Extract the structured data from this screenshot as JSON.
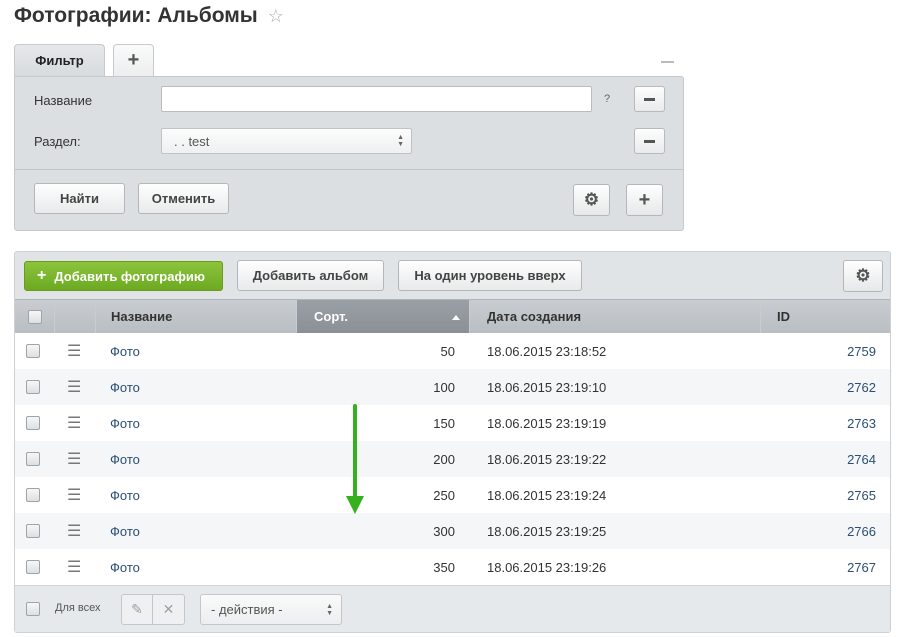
{
  "page": {
    "title": "Фотографии: Альбомы"
  },
  "filter": {
    "tab_label": "Фильтр",
    "name_label": "Название",
    "name_value": "",
    "help_mark": "?",
    "section_label": "Раздел:",
    "section_value": ". . test",
    "find_button": "Найти",
    "cancel_button": "Отменить"
  },
  "toolbar": {
    "add_photo": "Добавить фотографию",
    "add_album": "Добавить альбом",
    "level_up": "На один уровень вверх"
  },
  "table": {
    "columns": [
      "Название",
      "Сорт.",
      "Дата создания",
      "ID"
    ],
    "sorted_column": "Сорт.",
    "rows": [
      {
        "name": "Фото",
        "sort": "50",
        "date": "18.06.2015 23:18:52",
        "id": "2759"
      },
      {
        "name": "Фото",
        "sort": "100",
        "date": "18.06.2015 23:19:10",
        "id": "2762"
      },
      {
        "name": "Фото",
        "sort": "150",
        "date": "18.06.2015 23:19:19",
        "id": "2763"
      },
      {
        "name": "Фото",
        "sort": "200",
        "date": "18.06.2015 23:19:22",
        "id": "2764"
      },
      {
        "name": "Фото",
        "sort": "250",
        "date": "18.06.2015 23:19:24",
        "id": "2765"
      },
      {
        "name": "Фото",
        "sort": "300",
        "date": "18.06.2015 23:19:25",
        "id": "2766"
      },
      {
        "name": "Фото",
        "sort": "350",
        "date": "18.06.2015 23:19:26",
        "id": "2767"
      }
    ]
  },
  "footer": {
    "for_all_label": "Для всех",
    "actions_select": "- действия -"
  },
  "colors": {
    "accent_green": "#7ab52e",
    "link_blue": "#2c4f73",
    "annotation_arrow": "#35b01e"
  },
  "icons": [
    "star-icon",
    "plus-icon",
    "minus-icon",
    "gear-icon",
    "drag-handle-icon",
    "pencil-icon",
    "close-icon",
    "sort-asc-icon",
    "down-arrow-icon"
  ]
}
